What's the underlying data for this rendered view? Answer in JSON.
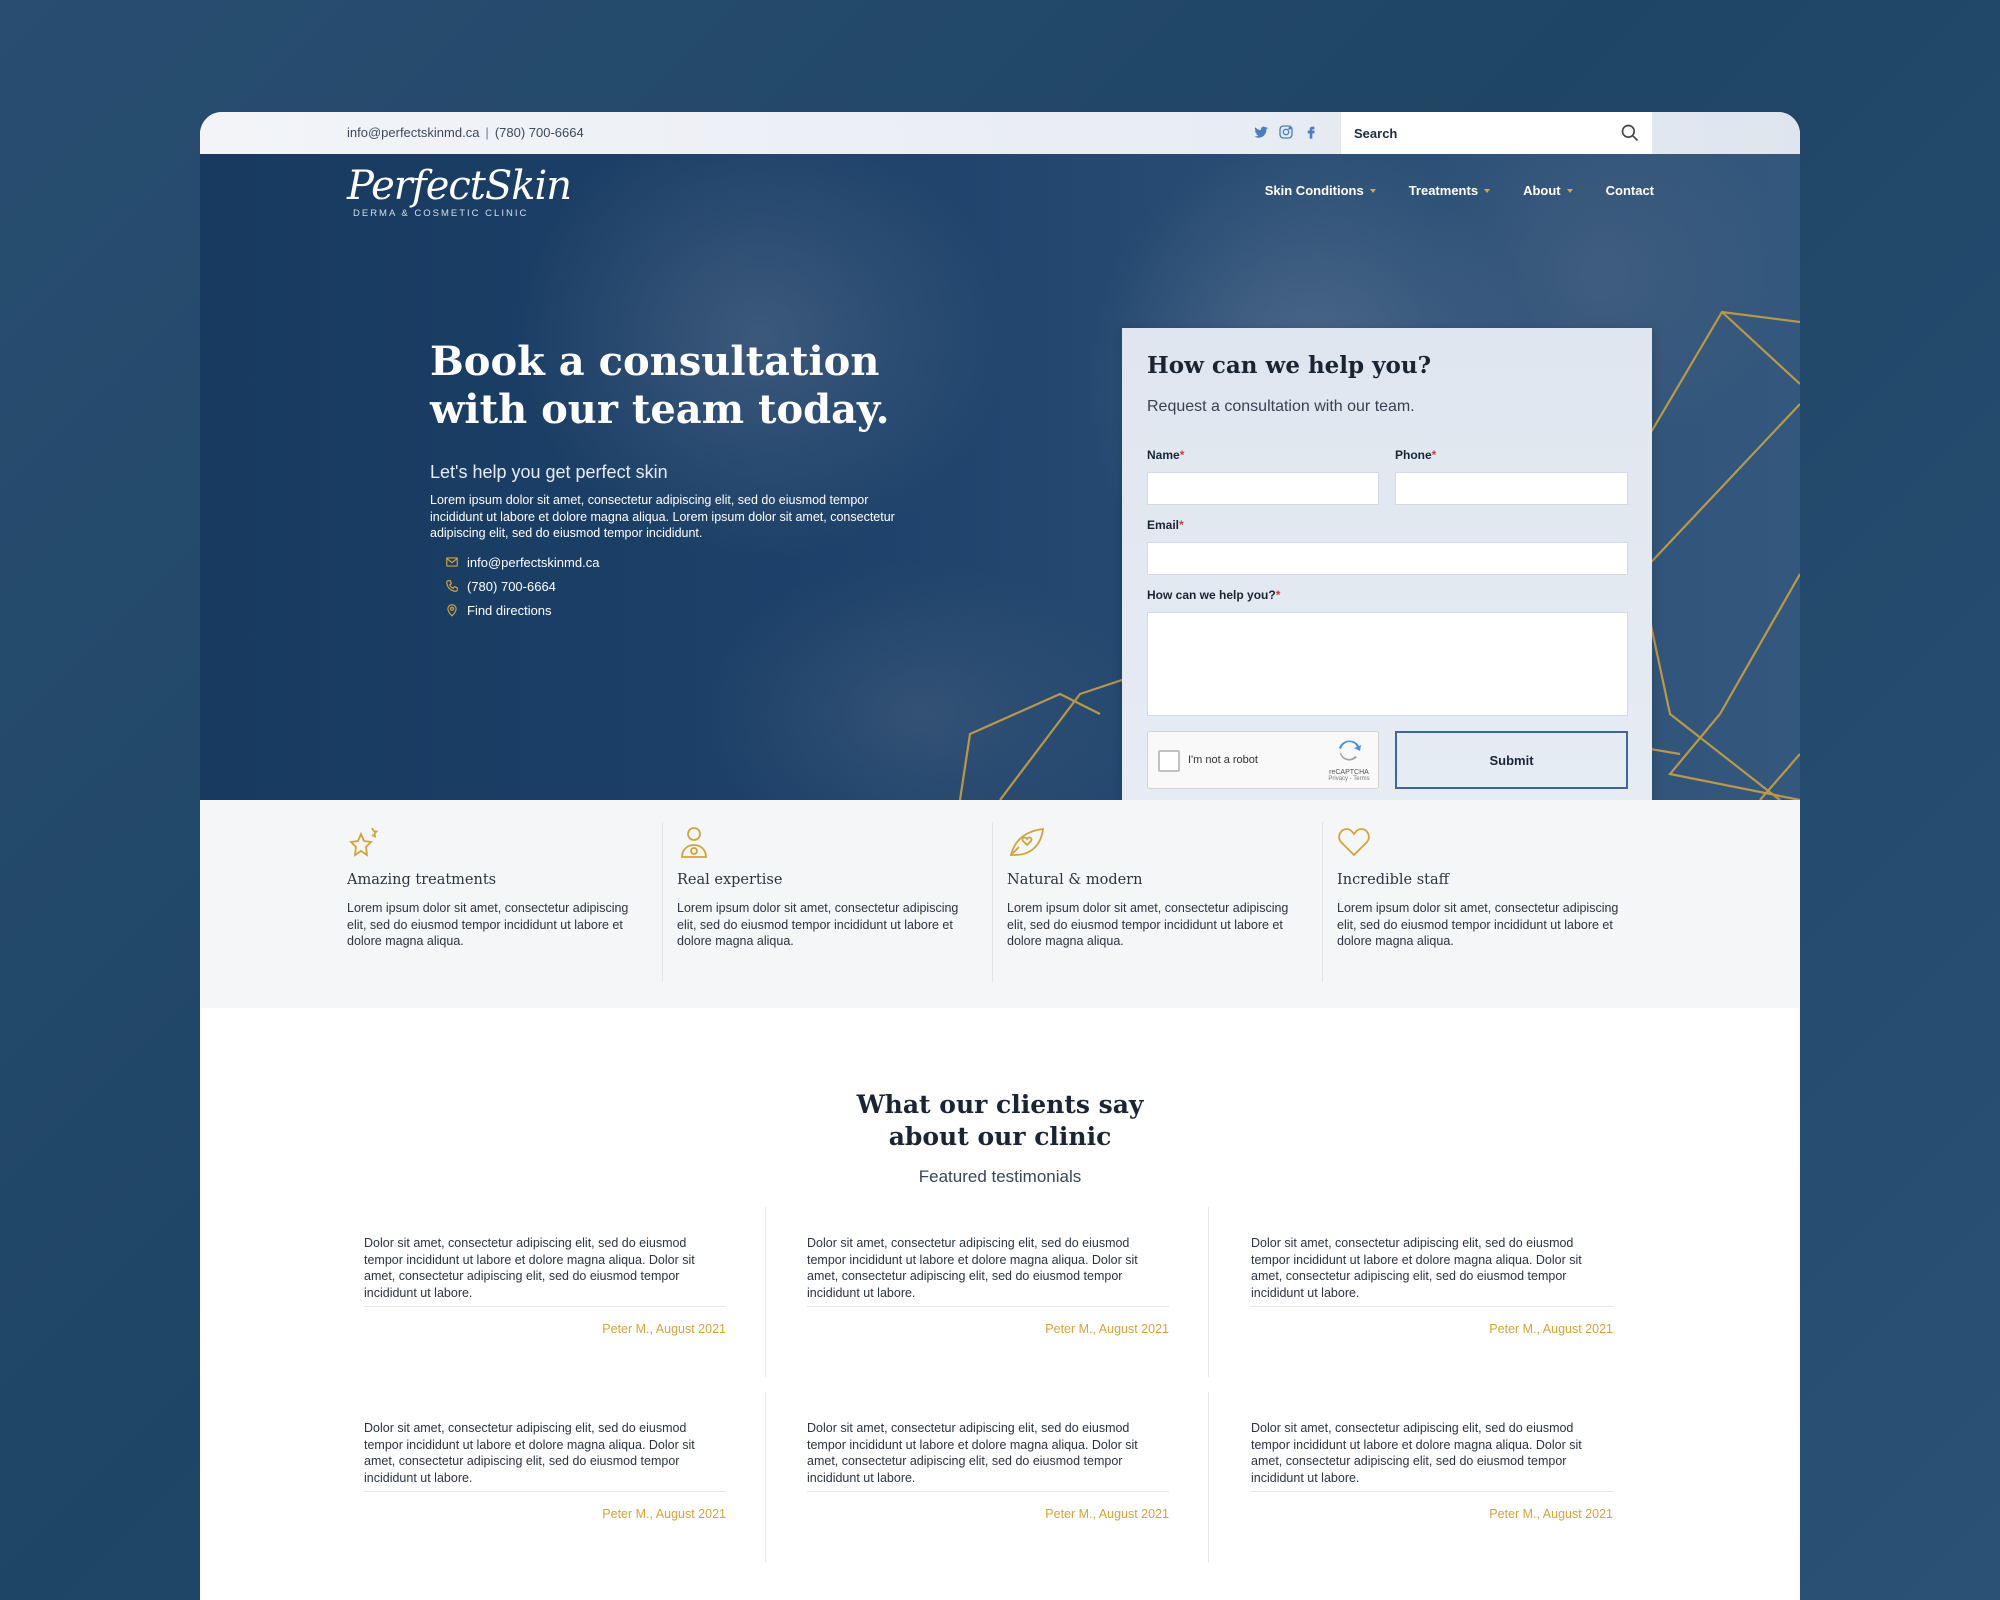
{
  "topbar": {
    "email": "info@perfectskinmd.ca",
    "separator": "|",
    "phone": "(780) 700-6664",
    "social": [
      "twitter-icon",
      "instagram-icon",
      "facebook-icon"
    ],
    "search_placeholder": "Search"
  },
  "logo": {
    "script": "PerfectSkin",
    "tagline": "DERMA & COSMETIC CLINIC"
  },
  "nav": [
    {
      "label": "Skin Conditions",
      "dropdown": true
    },
    {
      "label": "Treatments",
      "dropdown": true
    },
    {
      "label": "About",
      "dropdown": true
    },
    {
      "label": "Contact",
      "dropdown": false
    }
  ],
  "hero": {
    "title": "Book a consultation with our team today.",
    "subtitle": "Let's help you get perfect skin",
    "body": "Lorem ipsum dolor sit amet, consectetur adipiscing elit, sed do eiusmod tempor incididunt ut labore et dolore magna aliqua. Lorem ipsum dolor sit amet, consectetur adipiscing elit, sed do eiusmod tempor incididunt.",
    "contacts": {
      "email": "info@perfectskinmd.ca",
      "phone": "(780) 700-6664",
      "directions": "Find directions"
    }
  },
  "form": {
    "title": "How can we help you?",
    "lead": "Request a consultation with our team.",
    "name_label": "Name",
    "phone_label": "Phone",
    "email_label": "Email",
    "message_label": "How can we help you?",
    "required_mark": "*",
    "captcha_text": "I'm not a robot",
    "captcha_brand": "reCAPTCHA",
    "captcha_terms": "Privacy - Terms",
    "submit_label": "Submit"
  },
  "features": [
    {
      "icon": "sparkle-stars-icon",
      "title": "Amazing treatments",
      "desc": "Lorem ipsum dolor sit amet, consectetur adipiscing elit, sed do eiusmod tempor incididunt ut labore et dolore magna aliqua."
    },
    {
      "icon": "expert-person-icon",
      "title": "Real expertise",
      "desc": "Lorem ipsum dolor sit amet, consectetur adipiscing elit, sed do eiusmod tempor incididunt ut labore et dolore magna aliqua."
    },
    {
      "icon": "leaf-heart-icon",
      "title": "Natural & modern",
      "desc": "Lorem ipsum dolor sit amet, consectetur adipiscing elit, sed do eiusmod tempor incididunt ut labore et dolore magna aliqua."
    },
    {
      "icon": "heart-icon",
      "title": "Incredible staff",
      "desc": "Lorem ipsum dolor sit amet, consectetur adipiscing elit, sed do eiusmod tempor incididunt ut labore et dolore magna aliqua."
    }
  ],
  "testimonials": {
    "heading": "What our clients say about our clinic",
    "subheading": "Featured testimonials",
    "items": [
      {
        "quote": "Dolor sit amet, consectetur adipiscing elit, sed do eiusmod tempor incididunt ut labore et dolore magna aliqua. Dolor sit amet, consectetur adipiscing elit, sed do eiusmod tempor incididunt ut labore.",
        "author": "Peter M., August 2021"
      },
      {
        "quote": "Dolor sit amet, consectetur adipiscing elit, sed do eiusmod tempor incididunt ut labore et dolore magna aliqua. Dolor sit amet, consectetur adipiscing elit, sed do eiusmod tempor incididunt ut labore.",
        "author": "Peter M., August 2021"
      },
      {
        "quote": "Dolor sit amet, consectetur adipiscing elit, sed do eiusmod tempor incididunt ut labore et dolore magna aliqua. Dolor sit amet, consectetur adipiscing elit, sed do eiusmod tempor incididunt ut labore.",
        "author": "Peter M., August 2021"
      },
      {
        "quote": "Dolor sit amet, consectetur adipiscing elit, sed do eiusmod tempor incididunt ut labore et dolore magna aliqua. Dolor sit amet, consectetur adipiscing elit, sed do eiusmod tempor incididunt ut labore.",
        "author": "Peter M., August 2021"
      },
      {
        "quote": "Dolor sit amet, consectetur adipiscing elit, sed do eiusmod tempor incididunt ut labore et dolore magna aliqua. Dolor sit amet, consectetur adipiscing elit, sed do eiusmod tempor incididunt ut labore.",
        "author": "Peter M., August 2021"
      },
      {
        "quote": "Dolor sit amet, consectetur adipiscing elit, sed do eiusmod tempor incididunt ut labore et dolore magna aliqua. Dolor sit amet, consectetur adipiscing elit, sed do eiusmod tempor incididunt ut labore.",
        "author": "Peter M., August 2021"
      }
    ]
  },
  "colors": {
    "brand_navy": "#1d416a",
    "accent_gold": "#d3a43a",
    "submit_border": "#3f6697",
    "required_red": "#d23b3b"
  }
}
